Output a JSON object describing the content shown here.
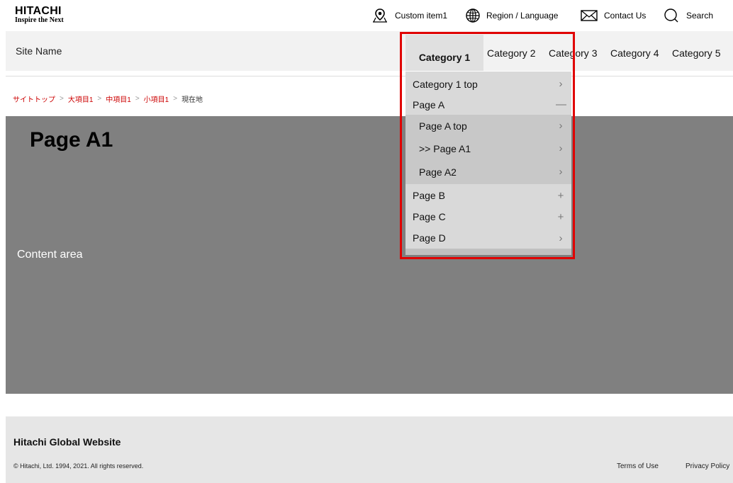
{
  "header": {
    "logo_brand": "HITACHI",
    "logo_tagline": "Inspire the Next",
    "utility": {
      "custom_item": "Custom item1",
      "region": "Region / Language",
      "contact": "Contact Us",
      "search": "Search"
    }
  },
  "site": {
    "name": "Site Name",
    "categories": [
      "Category 1",
      "Category 2",
      "Category 3",
      "Category 4",
      "Category 5"
    ],
    "active_category": "Category 1"
  },
  "breadcrumb": {
    "items": [
      "サイトトップ",
      "大項目1",
      "中項目1",
      "小項目1"
    ],
    "current": "現在地",
    "separator": ">"
  },
  "content": {
    "page_title": "Page A1",
    "label": "Content area"
  },
  "dropdown": {
    "top": {
      "label": "Category 1 top",
      "indicator": "›"
    },
    "page_a": {
      "label": "Page A",
      "indicator": "—"
    },
    "sub_items": [
      {
        "label": "Page A top",
        "indicator": "›"
      },
      {
        "label": ">> Page A1",
        "indicator": "›"
      },
      {
        "label": "Page A2",
        "indicator": "›"
      }
    ],
    "page_b": {
      "label": "Page B",
      "indicator": "+"
    },
    "page_c": {
      "label": "Page C",
      "indicator": "+"
    },
    "page_d": {
      "label": "Page D",
      "indicator": "›"
    }
  },
  "footer": {
    "title": "Hitachi Global Website",
    "copyright": "© Hitachi, Ltd. 1994, 2021. All rights reserved.",
    "links": [
      "Terms of Use",
      "Privacy Policy"
    ]
  },
  "colors": {
    "breadcrumb_link": "#cc0000",
    "highlight": "#e00000",
    "content_bg": "#808080",
    "site_bar_bg": "#f2f2f2",
    "footer_bg": "#e6e6e6"
  },
  "icons": [
    "map-pin-icon",
    "globe-icon",
    "mail-icon",
    "search-icon",
    "chevron-right-icon",
    "minus-icon",
    "plus-icon"
  ]
}
